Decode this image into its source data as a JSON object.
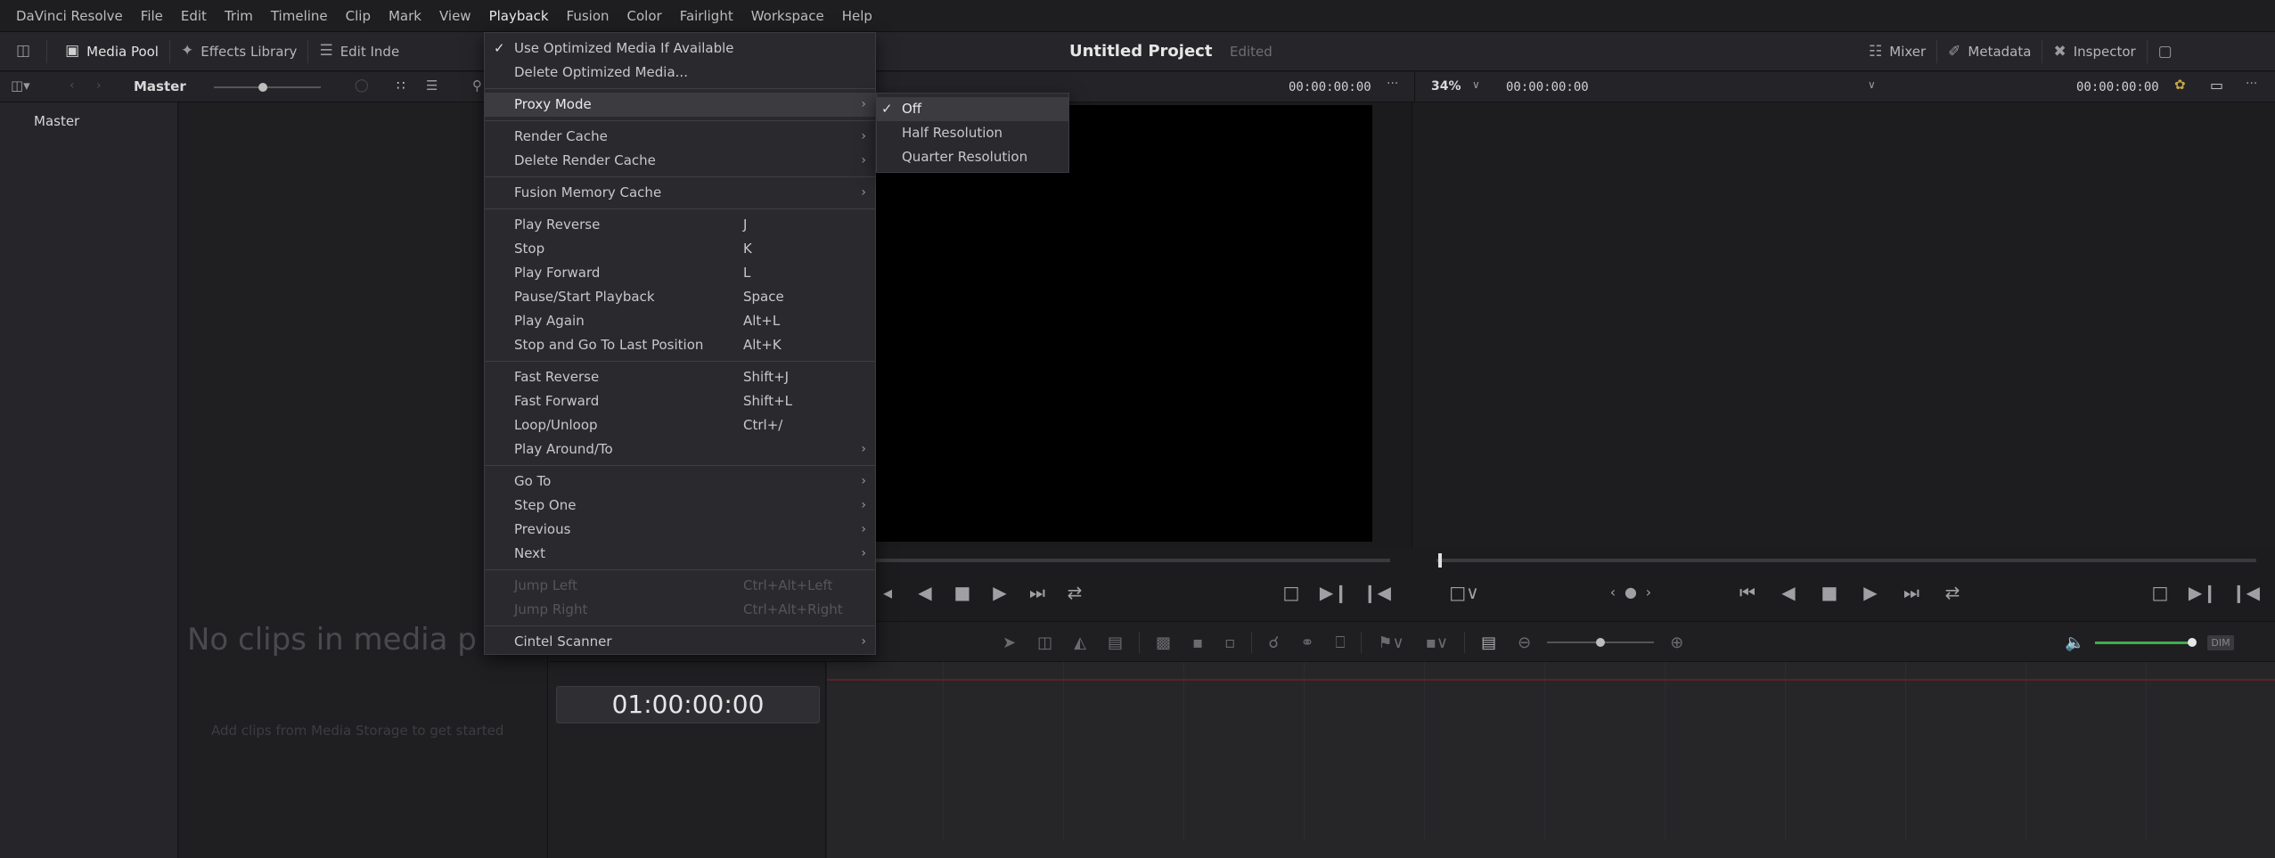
{
  "menubar": {
    "items": [
      "DaVinci Resolve",
      "File",
      "Edit",
      "Trim",
      "Timeline",
      "Clip",
      "Mark",
      "View",
      "Playback",
      "Fusion",
      "Color",
      "Fairlight",
      "Workspace",
      "Help"
    ],
    "active": "Playback"
  },
  "toolbar": {
    "media_pool": "Media Pool",
    "effects_library": "Effects Library",
    "edit_index": "Edit Inde",
    "mixer": "Mixer",
    "metadata": "Metadata",
    "inspector": "Inspector"
  },
  "project": {
    "title": "Untitled Project",
    "status": "Edited"
  },
  "subbar": {
    "bin_name": "Master",
    "source_timecode": "00:00:00:00",
    "zoom": "34%",
    "program_timecode_left": "00:00:00:00",
    "program_timecode_right": "00:00:00:00"
  },
  "bins": {
    "items": [
      "Master"
    ]
  },
  "media_pool": {
    "empty_text": "No clips in media p",
    "hint": "Add clips from Media Storage to get started"
  },
  "timeline": {
    "timecode": "01:00:00:00"
  },
  "playback_menu": {
    "groups": [
      [
        {
          "label": "Use Optimized Media If Available",
          "checked": true
        },
        {
          "label": "Delete Optimized Media..."
        }
      ],
      [
        {
          "label": "Proxy Mode",
          "submenu": true,
          "highlighted": true
        }
      ],
      [
        {
          "label": "Render Cache",
          "submenu": true
        },
        {
          "label": "Delete Render Cache",
          "submenu": true
        }
      ],
      [
        {
          "label": "Fusion Memory Cache",
          "submenu": true
        }
      ],
      [
        {
          "label": "Play Reverse",
          "shortcut": "J"
        },
        {
          "label": "Stop",
          "shortcut": "K"
        },
        {
          "label": "Play Forward",
          "shortcut": "L"
        },
        {
          "label": "Pause/Start Playback",
          "shortcut": "Space"
        },
        {
          "label": "Play Again",
          "shortcut": "Alt+L"
        },
        {
          "label": "Stop and Go To Last Position",
          "shortcut": "Alt+K"
        }
      ],
      [
        {
          "label": "Fast Reverse",
          "shortcut": "Shift+J"
        },
        {
          "label": "Fast Forward",
          "shortcut": "Shift+L"
        },
        {
          "label": "Loop/Unloop",
          "shortcut": "Ctrl+/"
        },
        {
          "label": "Play Around/To",
          "submenu": true
        }
      ],
      [
        {
          "label": "Go To",
          "submenu": true
        },
        {
          "label": "Step One",
          "submenu": true
        },
        {
          "label": "Previous",
          "submenu": true
        },
        {
          "label": "Next",
          "submenu": true
        }
      ],
      [
        {
          "label": "Jump Left",
          "shortcut": "Ctrl+Alt+Left",
          "disabled": true
        },
        {
          "label": "Jump Right",
          "shortcut": "Ctrl+Alt+Right",
          "disabled": true
        }
      ],
      [
        {
          "label": "Cintel Scanner",
          "submenu": true
        }
      ]
    ]
  },
  "proxy_submenu": {
    "items": [
      {
        "label": "Off",
        "checked": true
      },
      {
        "label": "Half Resolution"
      },
      {
        "label": "Quarter Resolution"
      }
    ]
  }
}
